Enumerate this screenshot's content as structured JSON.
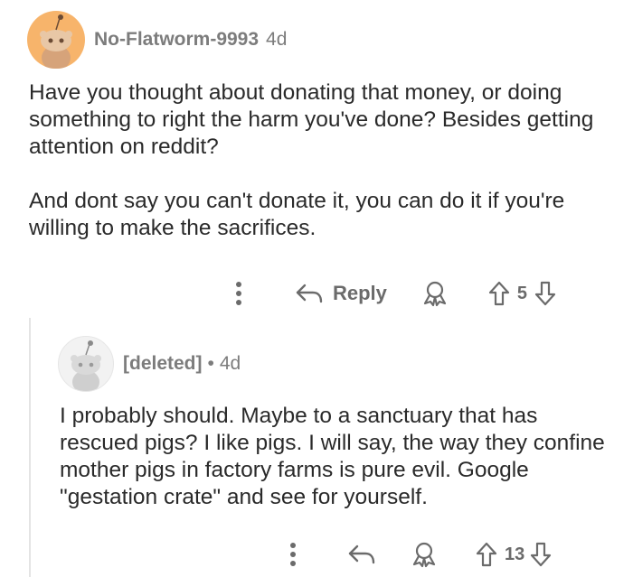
{
  "top_comment": {
    "username": "No-Flatworm-9993",
    "time": "4d",
    "paragraphs": [
      "Have you thought about donating that money, or doing something to right the harm you've done? Besides getting attention on reddit?",
      "And dont say you can't donate it, you can do it if you're willing to make the sacrifices."
    ],
    "reply_label": "Reply",
    "score": "5",
    "avatar_color": "#f7b46b"
  },
  "reply_comment": {
    "username": "[deleted]",
    "separator": "•",
    "time": "4d",
    "text": "I probably should. Maybe to a sanctuary that has rescued pigs? I like pigs. I will say, the way they confine mother pigs in factory farms is pure evil. Google \"gestation crate\" and see for yourself.",
    "score": "13",
    "avatar_color": "#d9d9d9"
  },
  "icons": {
    "more": "more-vertical-icon",
    "reply": "reply-arrow-icon",
    "award": "award-icon",
    "upvote": "upvote-icon",
    "downvote": "downvote-icon"
  }
}
